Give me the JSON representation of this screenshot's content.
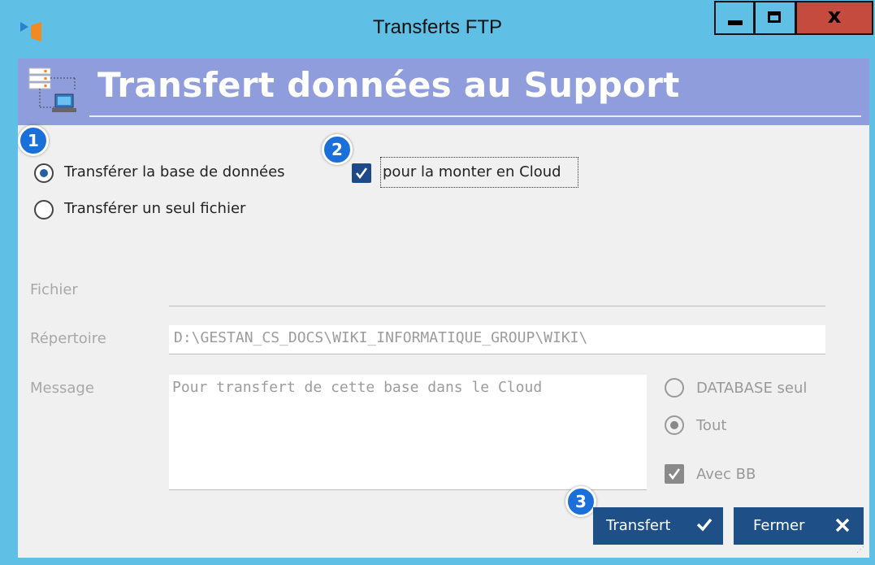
{
  "window": {
    "title": "Transferts FTP",
    "controls": {
      "minimize": "minimize",
      "maximize": "maximize",
      "close": "x"
    }
  },
  "header": {
    "title": "Transfert données au Support"
  },
  "options": {
    "transfer_db_label": "Transférer la base de données",
    "transfer_db_checked": true,
    "transfer_file_label": "Transférer un seul fichier",
    "transfer_file_checked": false,
    "cloud_label": "pour la monter en Cloud",
    "cloud_checked": true
  },
  "form": {
    "fichier_label": "Fichier",
    "fichier_value": "",
    "repertoire_label": "Répertoire",
    "repertoire_value": "D:\\GESTAN_CS_DOCS\\WIKI_INFORMATIQUE_GROUP\\WIKI\\",
    "message_label": "Message",
    "message_value": "Pour transfert de cette base dans le Cloud"
  },
  "scope": {
    "database_only_label": "DATABASE seul",
    "all_label": "Tout",
    "with_bb_label": "Avec BB",
    "with_bb_checked": true
  },
  "buttons": {
    "transfert": "Transfert",
    "fermer": "Fermer"
  },
  "badges": [
    "1",
    "2",
    "3"
  ],
  "colors": {
    "titlebar": "#5fbfe5",
    "header": "#8f9ddc",
    "button": "#1e4f86",
    "badge": "#1a6fd8",
    "close_button": "#c54b3f"
  }
}
